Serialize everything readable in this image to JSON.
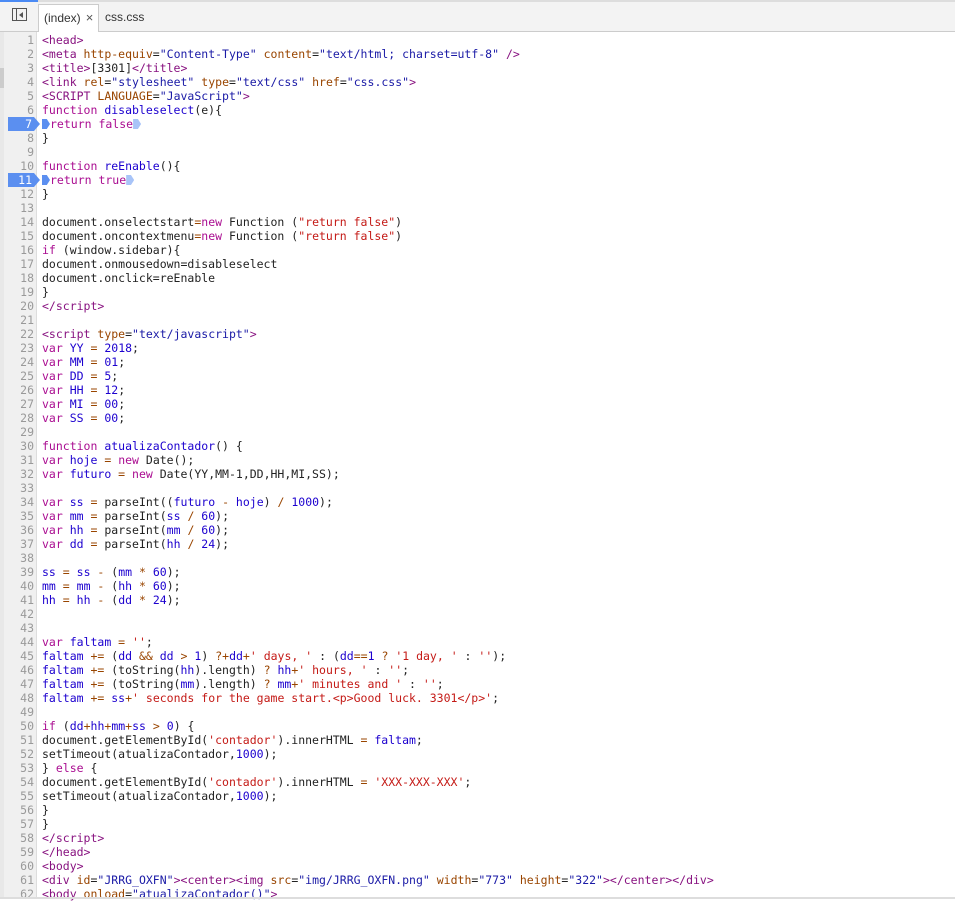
{
  "tabs": [
    {
      "label": "(index)",
      "close": "×"
    },
    {
      "label": "css.css"
    }
  ],
  "breakpoint_lines": [
    7,
    11
  ],
  "lines": [
    [
      [
        "t",
        "<head>"
      ]
    ],
    [
      [
        "t",
        "<meta "
      ],
      [
        "a",
        "http-equiv"
      ],
      [
        "p",
        "="
      ],
      [
        "v",
        "\"Content-Type\""
      ],
      [
        "p",
        " "
      ],
      [
        "a",
        "content"
      ],
      [
        "p",
        "="
      ],
      [
        "v",
        "\"text/html; charset=utf-8\""
      ],
      [
        "p",
        " "
      ],
      [
        "t",
        "/>"
      ]
    ],
    [
      [
        "t",
        "<title>"
      ],
      [
        "p",
        "[3301]"
      ],
      [
        "t",
        "</title>"
      ]
    ],
    [
      [
        "t",
        "<link "
      ],
      [
        "a",
        "rel"
      ],
      [
        "p",
        "="
      ],
      [
        "v",
        "\"stylesheet\""
      ],
      [
        "p",
        " "
      ],
      [
        "a",
        "type"
      ],
      [
        "p",
        "="
      ],
      [
        "v",
        "\"text/css\""
      ],
      [
        "p",
        " "
      ],
      [
        "a",
        "href"
      ],
      [
        "p",
        "="
      ],
      [
        "v",
        "\"css.css\""
      ],
      [
        "t",
        ">"
      ]
    ],
    [
      [
        "t",
        "<SCRIPT "
      ],
      [
        "a",
        "LANGUAGE"
      ],
      [
        "p",
        "="
      ],
      [
        "v",
        "\"JavaScript\""
      ],
      [
        "t",
        ">"
      ]
    ],
    [
      [
        "k",
        "function "
      ],
      [
        "d",
        "disableselect"
      ],
      [
        "p",
        "(e){"
      ]
    ],
    [
      [
        "bp",
        ""
      ],
      [
        "k",
        "return false"
      ],
      [
        "bpe",
        ""
      ]
    ],
    [
      [
        "p",
        "}"
      ]
    ],
    [],
    [
      [
        "k",
        "function "
      ],
      [
        "d",
        "reEnable"
      ],
      [
        "p",
        "(){"
      ]
    ],
    [
      [
        "bp",
        ""
      ],
      [
        "k",
        "return true"
      ],
      [
        "bpe",
        ""
      ]
    ],
    [
      [
        "p",
        "}"
      ]
    ],
    [],
    [
      [
        "p",
        "document.onselectstart"
      ],
      [
        "o",
        "="
      ],
      [
        "k",
        "new "
      ],
      [
        "p",
        "Function ("
      ],
      [
        "s",
        "\"return false\""
      ],
      [
        "p",
        ")"
      ]
    ],
    [
      [
        "p",
        "document.oncontextmenu"
      ],
      [
        "o",
        "="
      ],
      [
        "k",
        "new "
      ],
      [
        "p",
        "Function ("
      ],
      [
        "s",
        "\"return false\""
      ],
      [
        "p",
        ")"
      ]
    ],
    [
      [
        "k",
        "if "
      ],
      [
        "p",
        "(window.sidebar){"
      ]
    ],
    [
      [
        "p",
        "document.onmousedown=disableselect"
      ]
    ],
    [
      [
        "p",
        "document.onclick=reEnable"
      ]
    ],
    [
      [
        "p",
        "}"
      ]
    ],
    [
      [
        "t",
        "</script>"
      ]
    ],
    [],
    [
      [
        "t",
        "<script "
      ],
      [
        "a",
        "type"
      ],
      [
        "p",
        "="
      ],
      [
        "v",
        "\"text/javascript\""
      ],
      [
        "t",
        ">"
      ]
    ],
    [
      [
        "k",
        "var "
      ],
      [
        "d",
        "YY"
      ],
      [
        "o",
        " = "
      ],
      [
        "n",
        "2018"
      ],
      [
        "p",
        ";"
      ]
    ],
    [
      [
        "k",
        "var "
      ],
      [
        "d",
        "MM"
      ],
      [
        "o",
        " = "
      ],
      [
        "n",
        "01"
      ],
      [
        "p",
        ";"
      ]
    ],
    [
      [
        "k",
        "var "
      ],
      [
        "d",
        "DD"
      ],
      [
        "o",
        " = "
      ],
      [
        "n",
        "5"
      ],
      [
        "p",
        ";"
      ]
    ],
    [
      [
        "k",
        "var "
      ],
      [
        "d",
        "HH"
      ],
      [
        "o",
        " = "
      ],
      [
        "n",
        "12"
      ],
      [
        "p",
        ";"
      ]
    ],
    [
      [
        "k",
        "var "
      ],
      [
        "d",
        "MI"
      ],
      [
        "o",
        " = "
      ],
      [
        "n",
        "00"
      ],
      [
        "p",
        ";"
      ]
    ],
    [
      [
        "k",
        "var "
      ],
      [
        "d",
        "SS"
      ],
      [
        "o",
        " = "
      ],
      [
        "n",
        "00"
      ],
      [
        "p",
        ";"
      ]
    ],
    [],
    [
      [
        "k",
        "function "
      ],
      [
        "d",
        "atualizaContador"
      ],
      [
        "p",
        "() {"
      ]
    ],
    [
      [
        "k",
        "var "
      ],
      [
        "d",
        "hoje"
      ],
      [
        "o",
        " = "
      ],
      [
        "k",
        "new "
      ],
      [
        "p",
        "Date();"
      ]
    ],
    [
      [
        "k",
        "var "
      ],
      [
        "d",
        "futuro"
      ],
      [
        "o",
        " = "
      ],
      [
        "k",
        "new "
      ],
      [
        "p",
        "Date(YY,MM-1,DD,HH,MI,SS);"
      ]
    ],
    [],
    [
      [
        "k",
        "var "
      ],
      [
        "d",
        "ss"
      ],
      [
        "o",
        " = "
      ],
      [
        "p",
        "parseInt(("
      ],
      [
        "d",
        "futuro"
      ],
      [
        "o",
        " - "
      ],
      [
        "d",
        "hoje"
      ],
      [
        "p",
        ") "
      ],
      [
        "o",
        "/ "
      ],
      [
        "n",
        "1000"
      ],
      [
        "p",
        ");"
      ]
    ],
    [
      [
        "k",
        "var "
      ],
      [
        "d",
        "mm"
      ],
      [
        "o",
        " = "
      ],
      [
        "p",
        "parseInt("
      ],
      [
        "d",
        "ss"
      ],
      [
        "o",
        " / "
      ],
      [
        "n",
        "60"
      ],
      [
        "p",
        ");"
      ]
    ],
    [
      [
        "k",
        "var "
      ],
      [
        "d",
        "hh"
      ],
      [
        "o",
        " = "
      ],
      [
        "p",
        "parseInt("
      ],
      [
        "d",
        "mm"
      ],
      [
        "o",
        " / "
      ],
      [
        "n",
        "60"
      ],
      [
        "p",
        ");"
      ]
    ],
    [
      [
        "k",
        "var "
      ],
      [
        "d",
        "dd"
      ],
      [
        "o",
        " = "
      ],
      [
        "p",
        "parseInt("
      ],
      [
        "d",
        "hh"
      ],
      [
        "o",
        " / "
      ],
      [
        "n",
        "24"
      ],
      [
        "p",
        ");"
      ]
    ],
    [],
    [
      [
        "d",
        "ss"
      ],
      [
        "o",
        " = "
      ],
      [
        "d",
        "ss"
      ],
      [
        "o",
        " - "
      ],
      [
        "p",
        "("
      ],
      [
        "d",
        "mm"
      ],
      [
        "o",
        " * "
      ],
      [
        "n",
        "60"
      ],
      [
        "p",
        ");"
      ]
    ],
    [
      [
        "d",
        "mm"
      ],
      [
        "o",
        " = "
      ],
      [
        "d",
        "mm"
      ],
      [
        "o",
        " - "
      ],
      [
        "p",
        "("
      ],
      [
        "d",
        "hh"
      ],
      [
        "o",
        " * "
      ],
      [
        "n",
        "60"
      ],
      [
        "p",
        ");"
      ]
    ],
    [
      [
        "d",
        "hh"
      ],
      [
        "o",
        " = "
      ],
      [
        "d",
        "hh"
      ],
      [
        "o",
        " - "
      ],
      [
        "p",
        "("
      ],
      [
        "d",
        "dd"
      ],
      [
        "o",
        " * "
      ],
      [
        "n",
        "24"
      ],
      [
        "p",
        ");"
      ]
    ],
    [],
    [],
    [
      [
        "k",
        "var "
      ],
      [
        "d",
        "faltam"
      ],
      [
        "o",
        " = "
      ],
      [
        "s",
        "''"
      ],
      [
        "p",
        ";"
      ]
    ],
    [
      [
        "d",
        "faltam"
      ],
      [
        "o",
        " += "
      ],
      [
        "p",
        "("
      ],
      [
        "d",
        "dd"
      ],
      [
        "o",
        " && "
      ],
      [
        "d",
        "dd"
      ],
      [
        "o",
        " > "
      ],
      [
        "n",
        "1"
      ],
      [
        "p",
        ") "
      ],
      [
        "o",
        "?"
      ],
      [
        "o",
        "+"
      ],
      [
        "d",
        "dd"
      ],
      [
        "o",
        "+"
      ],
      [
        "s",
        "' days, '"
      ],
      [
        "p",
        " : ("
      ],
      [
        "d",
        "dd"
      ],
      [
        "o",
        "=="
      ],
      [
        "n",
        "1"
      ],
      [
        "o",
        " ? "
      ],
      [
        "s",
        "'1 day, '"
      ],
      [
        "p",
        " : "
      ],
      [
        "s",
        "''"
      ],
      [
        "p",
        ");"
      ]
    ],
    [
      [
        "d",
        "faltam"
      ],
      [
        "o",
        " += "
      ],
      [
        "p",
        "(toString("
      ],
      [
        "d",
        "hh"
      ],
      [
        "p",
        ").length) "
      ],
      [
        "o",
        "? "
      ],
      [
        "d",
        "hh"
      ],
      [
        "o",
        "+"
      ],
      [
        "s",
        "' hours, '"
      ],
      [
        "p",
        " : "
      ],
      [
        "s",
        "''"
      ],
      [
        "p",
        ";"
      ]
    ],
    [
      [
        "d",
        "faltam"
      ],
      [
        "o",
        " += "
      ],
      [
        "p",
        "(toString("
      ],
      [
        "d",
        "mm"
      ],
      [
        "p",
        ").length) "
      ],
      [
        "o",
        "? "
      ],
      [
        "d",
        "mm"
      ],
      [
        "o",
        "+"
      ],
      [
        "s",
        "' minutes and '"
      ],
      [
        "p",
        " : "
      ],
      [
        "s",
        "''"
      ],
      [
        "p",
        ";"
      ]
    ],
    [
      [
        "d",
        "faltam"
      ],
      [
        "o",
        " += "
      ],
      [
        "d",
        "ss"
      ],
      [
        "o",
        "+"
      ],
      [
        "s",
        "' seconds for the game start.<p>Good luck. 3301</p>'"
      ],
      [
        "p",
        ";"
      ]
    ],
    [],
    [
      [
        "k",
        "if "
      ],
      [
        "p",
        "("
      ],
      [
        "d",
        "dd"
      ],
      [
        "o",
        "+"
      ],
      [
        "d",
        "hh"
      ],
      [
        "o",
        "+"
      ],
      [
        "d",
        "mm"
      ],
      [
        "o",
        "+"
      ],
      [
        "d",
        "ss"
      ],
      [
        "o",
        " > "
      ],
      [
        "n",
        "0"
      ],
      [
        "p",
        ") {"
      ]
    ],
    [
      [
        "p",
        "document.getElementById("
      ],
      [
        "s",
        "'contador'"
      ],
      [
        "p",
        ").innerHTML "
      ],
      [
        "o",
        "= "
      ],
      [
        "d",
        "faltam"
      ],
      [
        "p",
        ";"
      ]
    ],
    [
      [
        "p",
        "setTimeout(atualizaContador,"
      ],
      [
        "n",
        "1000"
      ],
      [
        "p",
        ");"
      ]
    ],
    [
      [
        "p",
        "} "
      ],
      [
        "k",
        "else"
      ],
      [
        "p",
        " {"
      ]
    ],
    [
      [
        "p",
        "document.getElementById("
      ],
      [
        "s",
        "'contador'"
      ],
      [
        "p",
        ").innerHTML "
      ],
      [
        "o",
        "= "
      ],
      [
        "s",
        "'XXX-XXX-XXX'"
      ],
      [
        "p",
        ";"
      ]
    ],
    [
      [
        "p",
        "setTimeout(atualizaContador,"
      ],
      [
        "n",
        "1000"
      ],
      [
        "p",
        ");"
      ]
    ],
    [
      [
        "p",
        "}"
      ]
    ],
    [
      [
        "p",
        "}"
      ]
    ],
    [
      [
        "t",
        "</script>"
      ]
    ],
    [
      [
        "t",
        "</head>"
      ]
    ],
    [
      [
        "t",
        "<body>"
      ]
    ],
    [
      [
        "t",
        "<div "
      ],
      [
        "a",
        "id"
      ],
      [
        "p",
        "="
      ],
      [
        "v",
        "\"JRRG_OXFN\""
      ],
      [
        "t",
        "><center><img "
      ],
      [
        "a",
        "src"
      ],
      [
        "p",
        "="
      ],
      [
        "v",
        "\"img/JRRG_OXFN.png\""
      ],
      [
        "p",
        " "
      ],
      [
        "a",
        "width"
      ],
      [
        "p",
        "="
      ],
      [
        "v",
        "\"773\""
      ],
      [
        "p",
        " "
      ],
      [
        "a",
        "height"
      ],
      [
        "p",
        "="
      ],
      [
        "v",
        "\"322\""
      ],
      [
        "t",
        "></center></div>"
      ]
    ],
    [
      [
        "t",
        "<body "
      ],
      [
        "a",
        "onload"
      ],
      [
        "p",
        "="
      ],
      [
        "v",
        "\"atualizaContador()\""
      ],
      [
        "t",
        ">"
      ]
    ]
  ]
}
